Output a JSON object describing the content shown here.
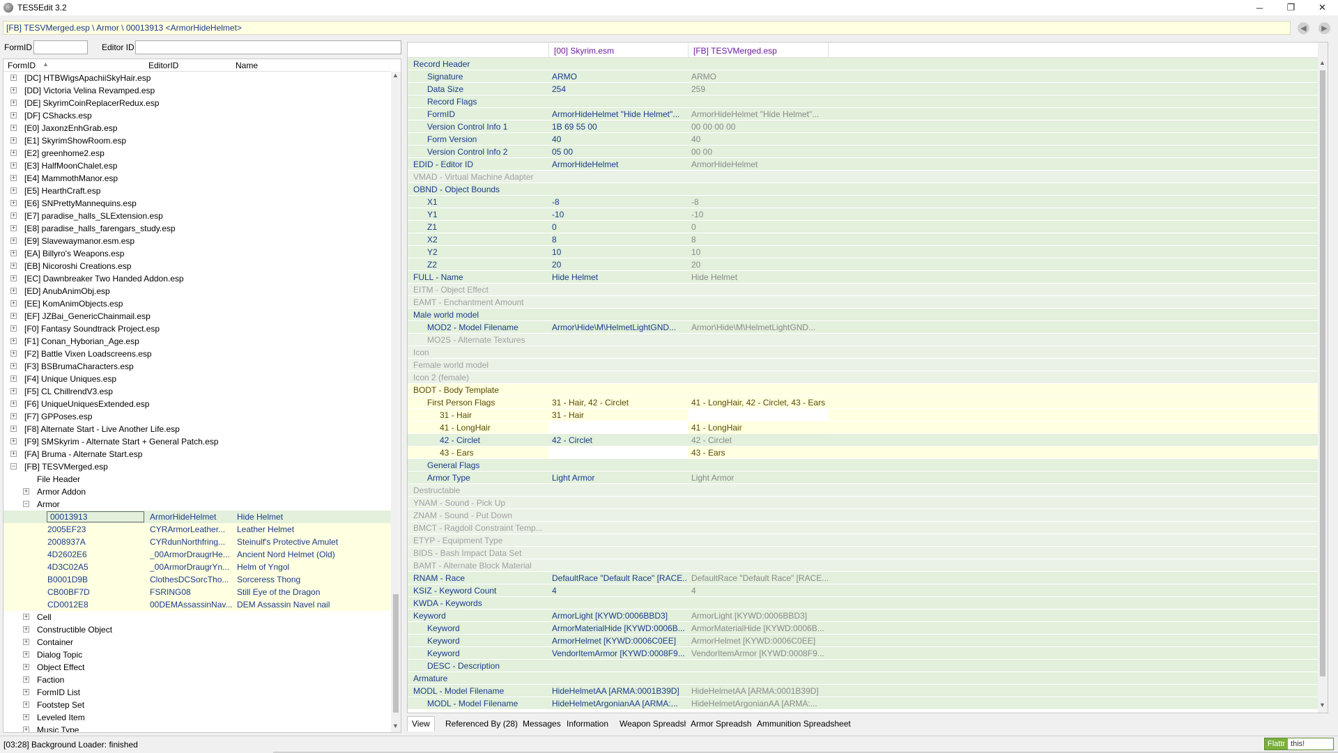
{
  "window": {
    "title": "TES5Edit 3.2",
    "minimize": "─",
    "restore": "❐",
    "close": "✕"
  },
  "path": "[FB] TESVMerged.esp \\ Armor \\ 00013913 <ArmorHideHelmet>",
  "filter": {
    "formid_label": "FormID",
    "formid_value": "",
    "editorid_label": "Editor ID",
    "editorid_value": ""
  },
  "tree": {
    "columns": [
      "FormID",
      "EditorID",
      "Name"
    ],
    "plugins": [
      "[DC] HTBWigsApachiiSkyHair.esp",
      "[DD] Victoria Velina Revamped.esp",
      "[DE] SkyrimCoinReplacerRedux.esp",
      "[DF] CShacks.esp",
      "[E0] JaxonzEnhGrab.esp",
      "[E1] SkyrimShowRoom.esp",
      "[E2] greenhome2.esp",
      "[E3] HalfMoonChalet.esp",
      "[E4] MammothManor.esp",
      "[E5] HearthCraft.esp",
      "[E6] SNPrettyMannequins.esp",
      "[E7] paradise_halls_SLExtension.esp",
      "[E8] paradise_halls_farengars_study.esp",
      "[E9] Slavewaymanor.esm.esp",
      "[EA] Billyro's Weapons.esp",
      "[EB] Nicoroshi Creations.esp",
      "[EC] Dawnbreaker Two Handed Addon.esp",
      "[ED] AnubAnimObj.esp",
      "[EE] KomAnimObjects.esp",
      "[EF] JZBai_GenericChainmail.esp",
      "[F0] Fantasy Soundtrack Project.esp",
      "[F1] Conan_Hyborian_Age.esp",
      "[F2] Battle Vixen Loadscreens.esp",
      "[F3] BSBrumaCharacters.esp",
      "[F4] Unique Uniques.esp",
      "[F5] CL ChillrendV3.esp",
      "[F6] UniqueUniquesExtended.esp",
      "[F7] GPPoses.esp",
      "[F8] Alternate Start - Live Another Life.esp",
      "[F9] SMSkyrim - Alternate Start + General Patch.esp",
      "[FA] Bruma - Alternate Start.esp",
      "[FB] TESVMerged.esp"
    ],
    "merged_children": [
      "File Header",
      "Armor Addon",
      "Armor"
    ],
    "armor_records": [
      {
        "formid": "00013913",
        "editorid": "ArmorHideHelmet",
        "name": "Hide Helmet"
      },
      {
        "formid": "2005EF23",
        "editorid": "CYRArmorLeather...",
        "name": "Leather Helmet"
      },
      {
        "formid": "2008937A",
        "editorid": "CYRdunNorthfring...",
        "name": "Steinulf's Protective Amulet"
      },
      {
        "formid": "4D2602E6",
        "editorid": "_00ArmorDraugrHe...",
        "name": "Ancient Nord Helmet (Old)"
      },
      {
        "formid": "4D3C02A5",
        "editorid": "_00ArmorDraugrYn...",
        "name": "Helm of Yngol"
      },
      {
        "formid": "B0001D9B",
        "editorid": "ClothesDCSorcTho...",
        "name": "Sorceress Thong"
      },
      {
        "formid": "CB00BF7D",
        "editorid": "FSRING08",
        "name": "Still Eye of the Dragon"
      },
      {
        "formid": "CD0012E8",
        "editorid": "00DEMAssassinNav...",
        "name": "DEM Assassin Navel nail"
      }
    ],
    "groups_after": [
      "Cell",
      "Constructible Object",
      "Container",
      "Dialog Topic",
      "Object Effect",
      "Faction",
      "FormID List",
      "Footstep Set",
      "Leveled Item",
      "Music Type"
    ]
  },
  "grid": {
    "headers": [
      "[00] Skyrim.esm",
      "[FB] TESVMerged.esp"
    ],
    "rows": [
      {
        "label": "Record Header",
        "v1": "",
        "v2": ""
      },
      {
        "label": "Signature",
        "v1": "ARMO",
        "v2": "ARMO"
      },
      {
        "label": "Data Size",
        "v1": "254",
        "v2": "259"
      },
      {
        "label": "Record Flags",
        "v1": "",
        "v2": ""
      },
      {
        "label": "FormID",
        "v1": "ArmorHideHelmet \"Hide Helmet\"...",
        "v2": "ArmorHideHelmet \"Hide Helmet\"..."
      },
      {
        "label": "Version Control Info 1",
        "v1": "1B 69 55 00",
        "v2": "00 00 00 00"
      },
      {
        "label": "Form Version",
        "v1": "40",
        "v2": "40"
      },
      {
        "label": "Version Control Info 2",
        "v1": "05 00",
        "v2": "00 00"
      },
      {
        "label": "EDID - Editor ID",
        "v1": "ArmorHideHelmet",
        "v2": "ArmorHideHelmet"
      },
      {
        "label": "VMAD - Virtual Machine Adapter",
        "v1": "",
        "v2": ""
      },
      {
        "label": "OBND - Object Bounds",
        "v1": "",
        "v2": ""
      },
      {
        "label": "X1",
        "v1": "-8",
        "v2": "-8"
      },
      {
        "label": "Y1",
        "v1": "-10",
        "v2": "-10"
      },
      {
        "label": "Z1",
        "v1": "0",
        "v2": "0"
      },
      {
        "label": "X2",
        "v1": "8",
        "v2": "8"
      },
      {
        "label": "Y2",
        "v1": "10",
        "v2": "10"
      },
      {
        "label": "Z2",
        "v1": "20",
        "v2": "20"
      },
      {
        "label": "FULL - Name",
        "v1": "Hide Helmet",
        "v2": "Hide Helmet"
      },
      {
        "label": "EITM - Object Effect",
        "v1": "",
        "v2": ""
      },
      {
        "label": "EAMT - Enchantment Amount",
        "v1": "",
        "v2": ""
      },
      {
        "label": "Male world model",
        "v1": "",
        "v2": ""
      },
      {
        "label": "MOD2 - Model Filename",
        "v1": "Armor\\Hide\\M\\HelmetLightGND...",
        "v2": "Armor\\Hide\\M\\HelmetLightGND..."
      },
      {
        "label": "MO2S - Alternate Textures",
        "v1": "",
        "v2": ""
      },
      {
        "label": "Icon",
        "v1": "",
        "v2": ""
      },
      {
        "label": "Female world model",
        "v1": "",
        "v2": ""
      },
      {
        "label": "Icon 2 (female)",
        "v1": "",
        "v2": ""
      },
      {
        "label": "BODT - Body Template",
        "v1": "",
        "v2": ""
      },
      {
        "label": "First Person Flags",
        "v1": "31 - Hair, 42 - Circlet",
        "v2": "41 - LongHair, 42 - Circlet, 43 - Ears"
      },
      {
        "label": "31 - Hair",
        "v1": "31 - Hair",
        "v2": ""
      },
      {
        "label": "41 - LongHair",
        "v1": "",
        "v2": "41 - LongHair"
      },
      {
        "label": "42 - Circlet",
        "v1": "42 - Circlet",
        "v2": "42 - Circlet"
      },
      {
        "label": "43 - Ears",
        "v1": "",
        "v2": "43 - Ears"
      },
      {
        "label": "General Flags",
        "v1": "",
        "v2": ""
      },
      {
        "label": "Armor Type",
        "v1": "Light Armor",
        "v2": "Light Armor"
      },
      {
        "label": "Destructable",
        "v1": "",
        "v2": ""
      },
      {
        "label": "YNAM - Sound - Pick Up",
        "v1": "",
        "v2": ""
      },
      {
        "label": "ZNAM - Sound - Put Down",
        "v1": "",
        "v2": ""
      },
      {
        "label": "BMCT - Ragdoll Constraint Temp...",
        "v1": "",
        "v2": ""
      },
      {
        "label": "ETYP - Equipment Type",
        "v1": "",
        "v2": ""
      },
      {
        "label": "BIDS - Bash Impact Data Set",
        "v1": "",
        "v2": ""
      },
      {
        "label": "BAMT - Alternate Block Material",
        "v1": "",
        "v2": ""
      },
      {
        "label": "RNAM - Race",
        "v1": "DefaultRace \"Default Race\" [RACE...",
        "v2": "DefaultRace \"Default Race\" [RACE..."
      },
      {
        "label": "KSIZ - Keyword Count",
        "v1": "4",
        "v2": "4"
      },
      {
        "label": "KWDA - Keywords",
        "v1": "",
        "v2": ""
      },
      {
        "label": "Keyword",
        "v1": "ArmorLight [KYWD:0006BBD3]",
        "v2": "ArmorLight [KYWD:0006BBD3]"
      },
      {
        "label": "Keyword",
        "v1": "ArmorMaterialHide [KYWD:0006B...",
        "v2": "ArmorMaterialHide [KYWD:0006B..."
      },
      {
        "label": "Keyword",
        "v1": "ArmorHelmet [KYWD:0006C0EE]",
        "v2": "ArmorHelmet [KYWD:0006C0EE]"
      },
      {
        "label": "Keyword",
        "v1": "VendorItemArmor [KYWD:0008F9...",
        "v2": "VendorItemArmor [KYWD:0008F9..."
      },
      {
        "label": "DESC - Description",
        "v1": "",
        "v2": ""
      },
      {
        "label": "Armature",
        "v1": "",
        "v2": ""
      },
      {
        "label": "MODL - Model Filename",
        "v1": "HideHelmetAA [ARMA:0001B39D]",
        "v2": "HideHelmetAA [ARMA:0001B39D]"
      },
      {
        "label": "MODL - Model Filename",
        "v1": "HideHelmetArgonianAA [ARMA:...",
        "v2": "HideHelmetArgonianAA [ARMA:..."
      }
    ]
  },
  "tabs": [
    "View",
    "Referenced By (28)",
    "Messages",
    "Information",
    "Weapon Spreadsheet",
    "Armor Spreadsheet",
    "Ammunition Spreadsheet"
  ],
  "status": "[03:28] Background Loader: finished",
  "flattr": {
    "left": "Flattr",
    "right": "this!"
  },
  "colors": {
    "green_row": "#e2f0dc",
    "yellow_row": "#ffffe1",
    "text_blue": "#1a3b8a",
    "header_purple": "#6a1b9a"
  }
}
